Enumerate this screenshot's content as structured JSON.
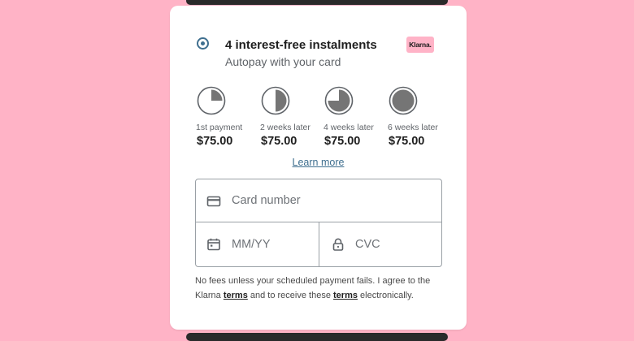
{
  "colors": {
    "background": "#ffb3c6",
    "accent": "#3f6f8f",
    "pie_fill": "#757575",
    "pie_outline": "#5f6368",
    "klarna_pink": "#ffb3c7"
  },
  "payment_option": {
    "selected": true,
    "title": "4 interest-free instalments",
    "subtitle": "Autopay with your card",
    "brand_badge": "Klarna."
  },
  "schedule": [
    {
      "label": "1st payment",
      "amount": "$75.00",
      "progress": 0.25,
      "icon": "pie-quarter-icon"
    },
    {
      "label": "2 weeks later",
      "amount": "$75.00",
      "progress": 0.5,
      "icon": "pie-half-icon"
    },
    {
      "label": "4 weeks later",
      "amount": "$75.00",
      "progress": 0.75,
      "icon": "pie-three-quarter-icon"
    },
    {
      "label": "6 weeks later",
      "amount": "$75.00",
      "progress": 1.0,
      "icon": "pie-full-icon"
    }
  ],
  "learn_more": "Learn more",
  "card_form": {
    "card_number": {
      "placeholder": "Card number",
      "value": "",
      "icon": "credit-card-icon"
    },
    "expiry": {
      "placeholder": "MM/YY",
      "value": "",
      "icon": "calendar-icon"
    },
    "cvc": {
      "placeholder": "CVC",
      "value": "",
      "icon": "lock-icon"
    }
  },
  "disclaimer": {
    "part1": "No fees unless your scheduled payment fails. I agree to the Klarna ",
    "link1": "terms",
    "part2": " and to receive these ",
    "link2": "terms",
    "part3": " electronically."
  }
}
